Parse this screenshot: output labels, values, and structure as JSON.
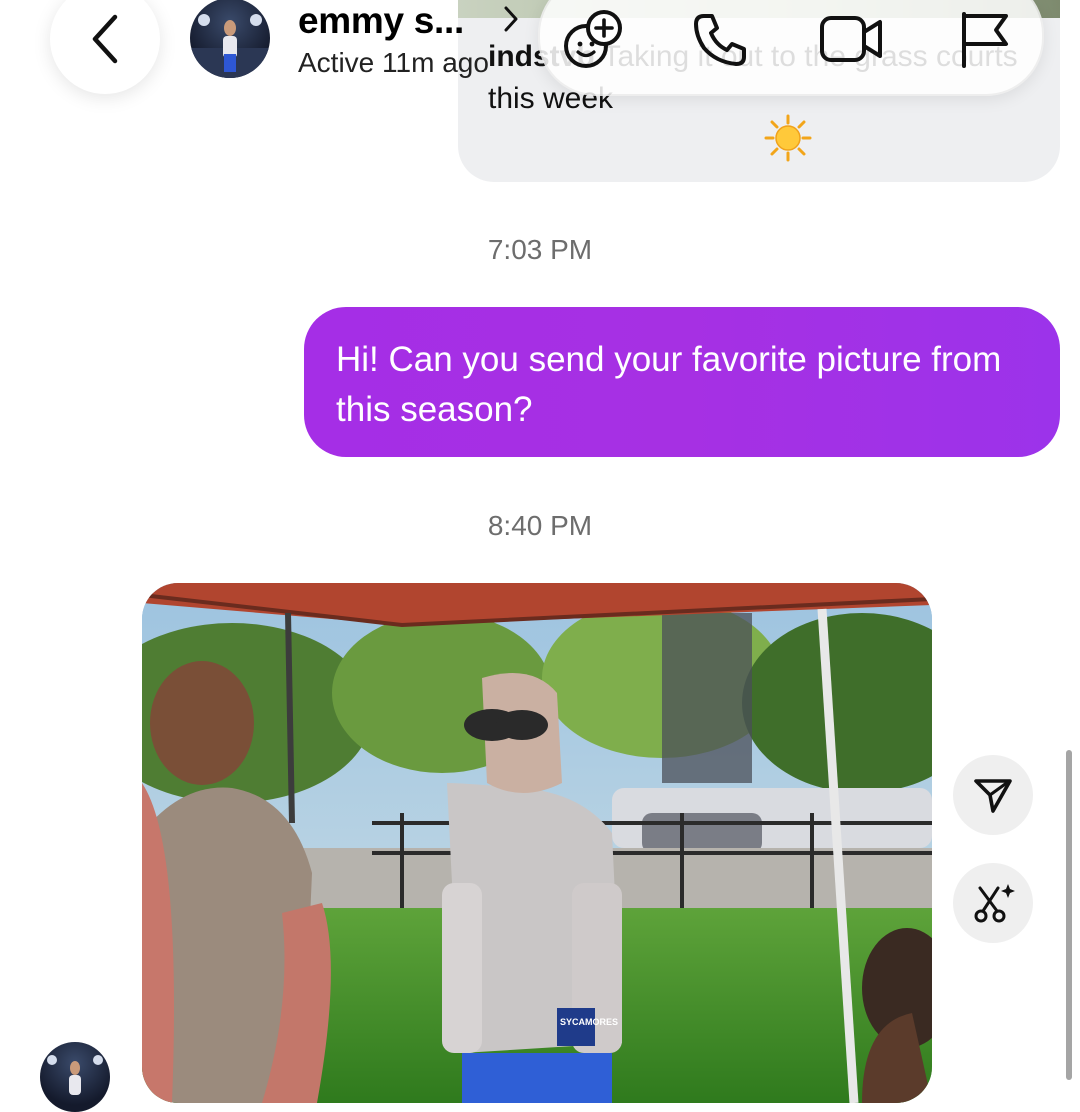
{
  "header": {
    "contact_name": "emmy s...",
    "status": "Active 11m ago",
    "icons": {
      "back": "chevron-left-icon",
      "name_chevron": "chevron-right-icon",
      "effects": "add-sticker-face-icon",
      "call": "phone-icon",
      "video": "video-camera-icon",
      "report": "flag-icon"
    }
  },
  "thread": {
    "shared_post": {
      "username": "indstvb",
      "caption": "Taking it out to the grass courts this week",
      "emoji": "sun-emoji"
    },
    "timestamp_1": "7:03 PM",
    "outgoing_message": "Hi! Can you send your favorite picture from this season?",
    "timestamp_2": "8:40 PM",
    "photo_message": {
      "alt": "photo-of-players-under-tent",
      "jersey_text": "SYCAMORES"
    }
  },
  "side_actions": {
    "share_icon": "send-paper-plane-icon",
    "edit_icon": "sparkle-scissors-icon"
  },
  "colors": {
    "outgoing_bubble": "#a630e3",
    "incoming_bubble": "#eeeff1",
    "timestamp": "#6d6d6d"
  }
}
